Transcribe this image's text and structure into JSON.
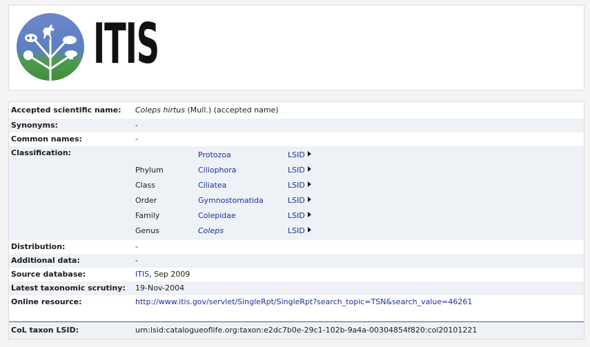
{
  "header": {
    "logo_text": "ITIS"
  },
  "fields": {
    "accepted": {
      "label": "Accepted scientific name:",
      "name_italic": "Coleps hirtus",
      "author": " (Mull.) (accepted name)"
    },
    "synonyms": {
      "label": "Synonyms:",
      "value": "-"
    },
    "common_names": {
      "label": "Common names:",
      "value": "-"
    },
    "classification": {
      "label": "Classification:",
      "lsid_label": "LSID",
      "items": [
        {
          "rank": "",
          "name": "Protozoa"
        },
        {
          "rank": "Phylum",
          "name": "Ciliophora"
        },
        {
          "rank": "Class",
          "name": "Ciliatea"
        },
        {
          "rank": "Order",
          "name": "Gymnostomatida"
        },
        {
          "rank": "Family",
          "name": "Colepidae"
        },
        {
          "rank": "Genus",
          "name": "Coleps"
        }
      ]
    },
    "distribution": {
      "label": "Distribution:",
      "value": "-"
    },
    "additional_data": {
      "label": "Additional data:",
      "value": "-"
    },
    "source_database": {
      "label": "Source database:",
      "link": "ITIS",
      "suffix": ", Sep 2009"
    },
    "latest_scrutiny": {
      "label": "Latest taxonomic scrutiny:",
      "value": "19-Nov-2004"
    },
    "online_resource": {
      "label": "Online resource:",
      "url": "http://www.itis.gov/servlet/SingleRpt/SingleRpt?search_topic=TSN&search_value=46261"
    },
    "col_lsid": {
      "label": "CoL taxon LSID:",
      "value": "urn:lsid:catalogueoflife.org:taxon:e2dc7b0e-29c1-102b-9a4a-00304854f820:col20101221"
    }
  },
  "colors": {
    "link": "#1a2f9c",
    "row_alt": "#eef2f6",
    "logo_sky": "#5b7fc4",
    "logo_land": "#4a9a3e"
  },
  "icons": [
    "itis-logo-icon",
    "lsid-arrow-icon"
  ]
}
